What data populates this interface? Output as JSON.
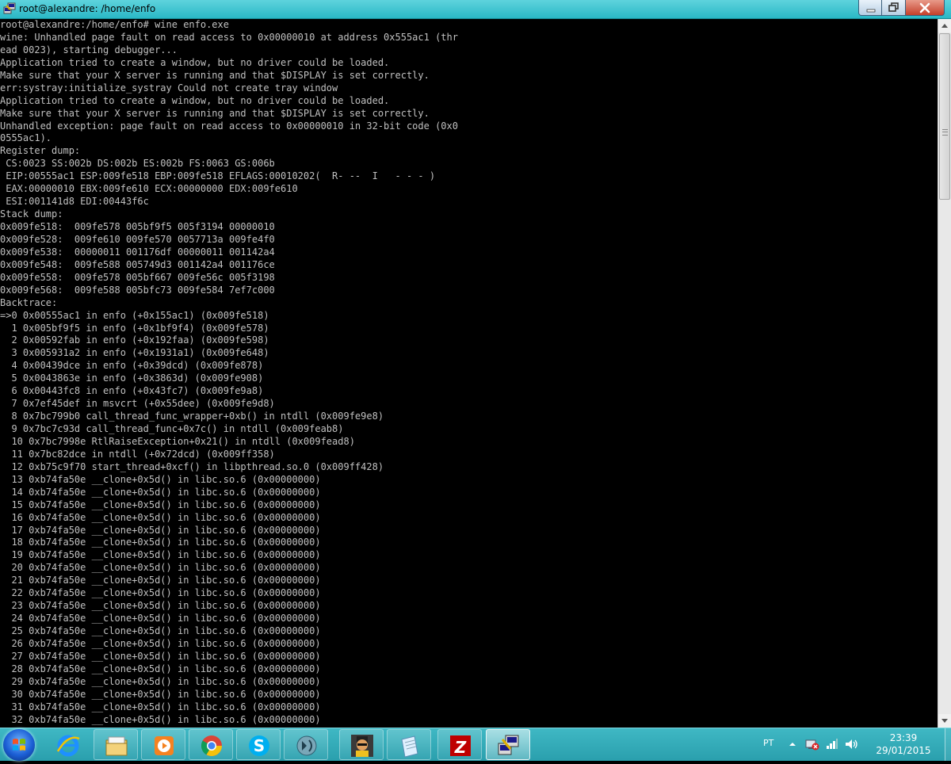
{
  "window": {
    "title": "root@alexandre: /home/enfo",
    "icon": "putty-terminal-icon"
  },
  "terminal": {
    "lines": [
      "root@alexandre:/home/enfo# wine enfo.exe",
      "wine: Unhandled page fault on read access to 0x00000010 at address 0x555ac1 (thr",
      "ead 0023), starting debugger...",
      "Application tried to create a window, but no driver could be loaded.",
      "Make sure that your X server is running and that $DISPLAY is set correctly.",
      "err:systray:initialize_systray Could not create tray window",
      "Application tried to create a window, but no driver could be loaded.",
      "Make sure that your X server is running and that $DISPLAY is set correctly.",
      "Unhandled exception: page fault on read access to 0x00000010 in 32-bit code (0x0",
      "0555ac1).",
      "Register dump:",
      " CS:0023 SS:002b DS:002b ES:002b FS:0063 GS:006b",
      " EIP:00555ac1 ESP:009fe518 EBP:009fe518 EFLAGS:00010202(  R- --  I   - - - )",
      " EAX:00000010 EBX:009fe610 ECX:00000000 EDX:009fe610",
      " ESI:001141d8 EDI:00443f6c",
      "Stack dump:",
      "0x009fe518:  009fe578 005bf9f5 005f3194 00000010",
      "0x009fe528:  009fe610 009fe570 0057713a 009fe4f0",
      "0x009fe538:  00000011 001176df 00000011 001142a4",
      "0x009fe548:  009fe588 005749d3 001142a4 001176ce",
      "0x009fe558:  009fe578 005bf667 009fe56c 005f3198",
      "0x009fe568:  009fe588 005bfc73 009fe584 7ef7c000",
      "Backtrace:",
      "=>0 0x00555ac1 in enfo (+0x155ac1) (0x009fe518)",
      "  1 0x005bf9f5 in enfo (+0x1bf9f4) (0x009fe578)",
      "  2 0x00592fab in enfo (+0x192faa) (0x009fe598)",
      "  3 0x005931a2 in enfo (+0x1931a1) (0x009fe648)",
      "  4 0x00439dce in enfo (+0x39dcd) (0x009fe878)",
      "  5 0x0043863e in enfo (+0x3863d) (0x009fe908)",
      "  6 0x00443fc8 in enfo (+0x43fc7) (0x009fe9a8)",
      "  7 0x7ef45def in msvcrt (+0x55dee) (0x009fe9d8)",
      "  8 0x7bc799b0 call_thread_func_wrapper+0xb() in ntdll (0x009fe9e8)",
      "  9 0x7bc7c93d call_thread_func+0x7c() in ntdll (0x009feab8)",
      "  10 0x7bc7998e RtlRaiseException+0x21() in ntdll (0x009fead8)",
      "  11 0x7bc82dce in ntdll (+0x72dcd) (0x009ff358)",
      "  12 0xb75c9f70 start_thread+0xcf() in libpthread.so.0 (0x009ff428)",
      "  13 0xb74fa50e __clone+0x5d() in libc.so.6 (0x00000000)",
      "  14 0xb74fa50e __clone+0x5d() in libc.so.6 (0x00000000)",
      "  15 0xb74fa50e __clone+0x5d() in libc.so.6 (0x00000000)",
      "  16 0xb74fa50e __clone+0x5d() in libc.so.6 (0x00000000)",
      "  17 0xb74fa50e __clone+0x5d() in libc.so.6 (0x00000000)",
      "  18 0xb74fa50e __clone+0x5d() in libc.so.6 (0x00000000)",
      "  19 0xb74fa50e __clone+0x5d() in libc.so.6 (0x00000000)",
      "  20 0xb74fa50e __clone+0x5d() in libc.so.6 (0x00000000)",
      "  21 0xb74fa50e __clone+0x5d() in libc.so.6 (0x00000000)",
      "  22 0xb74fa50e __clone+0x5d() in libc.so.6 (0x00000000)",
      "  23 0xb74fa50e __clone+0x5d() in libc.so.6 (0x00000000)",
      "  24 0xb74fa50e __clone+0x5d() in libc.so.6 (0x00000000)",
      "  25 0xb74fa50e __clone+0x5d() in libc.so.6 (0x00000000)",
      "  26 0xb74fa50e __clone+0x5d() in libc.so.6 (0x00000000)",
      "  27 0xb74fa50e __clone+0x5d() in libc.so.6 (0x00000000)",
      "  28 0xb74fa50e __clone+0x5d() in libc.so.6 (0x00000000)",
      "  29 0xb74fa50e __clone+0x5d() in libc.so.6 (0x00000000)",
      "  30 0xb74fa50e __clone+0x5d() in libc.so.6 (0x00000000)",
      "  31 0xb74fa50e __clone+0x5d() in libc.so.6 (0x00000000)",
      "  32 0xb74fa50e __clone+0x5d() in libc.so.6 (0x00000000)"
    ]
  },
  "taskbar": {
    "start_icon": "windows-start-icon",
    "items": [
      {
        "name": "internet-explorer-icon"
      },
      {
        "name": "file-explorer-icon"
      },
      {
        "name": "media-player-icon"
      },
      {
        "name": "chrome-icon"
      },
      {
        "name": "skype-icon"
      },
      {
        "name": "audio-app-icon"
      },
      {
        "name": "user-avatar-app-icon"
      },
      {
        "name": "notepad-app-icon"
      },
      {
        "name": "filezilla-icon"
      },
      {
        "name": "putty-icon"
      }
    ],
    "tray": {
      "language": "PT",
      "time": "23:39",
      "date": "29/01/2015"
    }
  },
  "colors": {
    "terminal_fg": "#c0c0c0",
    "terminal_bg": "#000000",
    "taskbar": "#2ab0bd",
    "titlebar": "#4cc8d4"
  }
}
